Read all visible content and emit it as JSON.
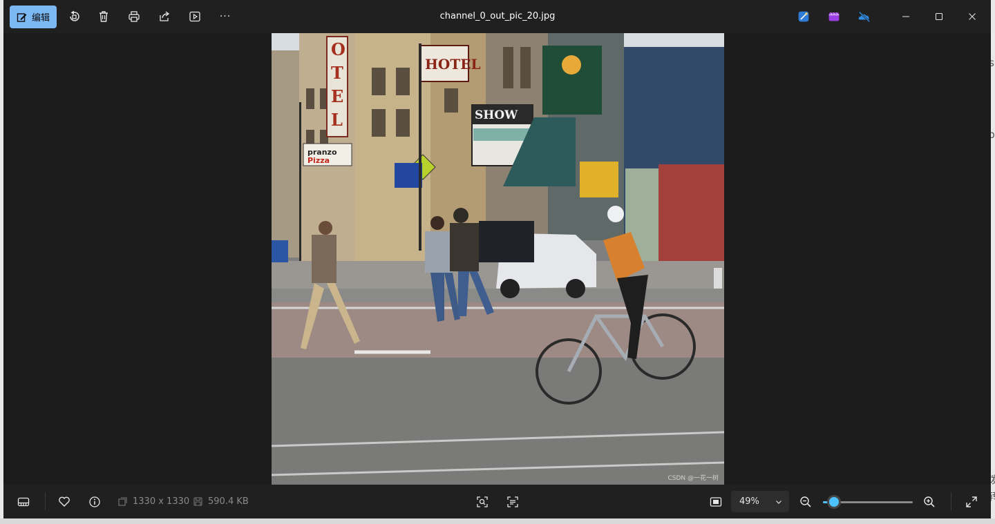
{
  "window": {
    "title": "channel_0_out_pic_20.jpg"
  },
  "toolbar": {
    "edit_label": "编辑",
    "icons": [
      "edit-icon",
      "rotate-icon",
      "delete-icon",
      "print-icon",
      "share-icon",
      "slideshow-icon",
      "more-icon"
    ],
    "more_glyph": "···",
    "accent": "#7cb8f2"
  },
  "photo": {
    "watermark": "CSDN @一花一树"
  },
  "bottombar": {
    "dimensions": "1330 x 1330",
    "file_size": "590.4 KB",
    "zoom_value": "49%",
    "zoom_level": 0.12,
    "accent": "#4cc2ff"
  },
  "side_glyphs": {
    "right": [
      "s",
      "p",
      "泼",
      "转"
    ]
  }
}
